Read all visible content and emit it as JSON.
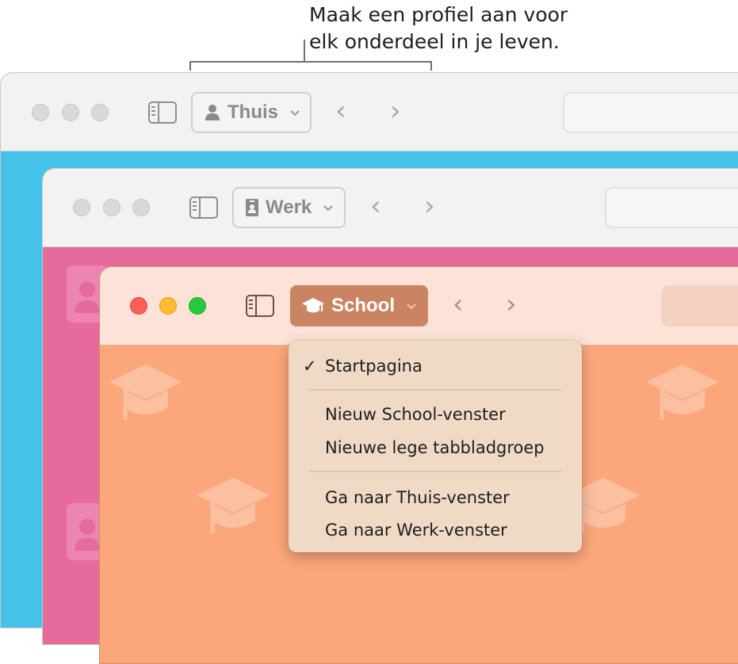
{
  "callout": {
    "line1": "Maak een profiel aan voor",
    "line2": "elk onderdeel in je leven."
  },
  "windows": {
    "home": {
      "profile_label": "Thuis",
      "profile_icon": "person-icon",
      "bg_color": "#45c2ea"
    },
    "work": {
      "profile_label": "Werk",
      "profile_icon": "badge-icon",
      "bg_color": "#e66b9c"
    },
    "school": {
      "profile_label": "School",
      "profile_icon": "graduation-cap-icon",
      "bg_color": "#fca67b",
      "accent": "#cb8462"
    }
  },
  "nav": {
    "back": "‹",
    "forward": "›"
  },
  "menu": {
    "checkmark": "✓",
    "items": [
      {
        "label": "Startpagina",
        "checked": true
      },
      {
        "label": "Nieuw School-venster"
      },
      {
        "label": "Nieuwe lege tabbladgroep"
      },
      {
        "label": "Ga naar Thuis-venster"
      },
      {
        "label": "Ga naar Werk-venster"
      }
    ]
  }
}
